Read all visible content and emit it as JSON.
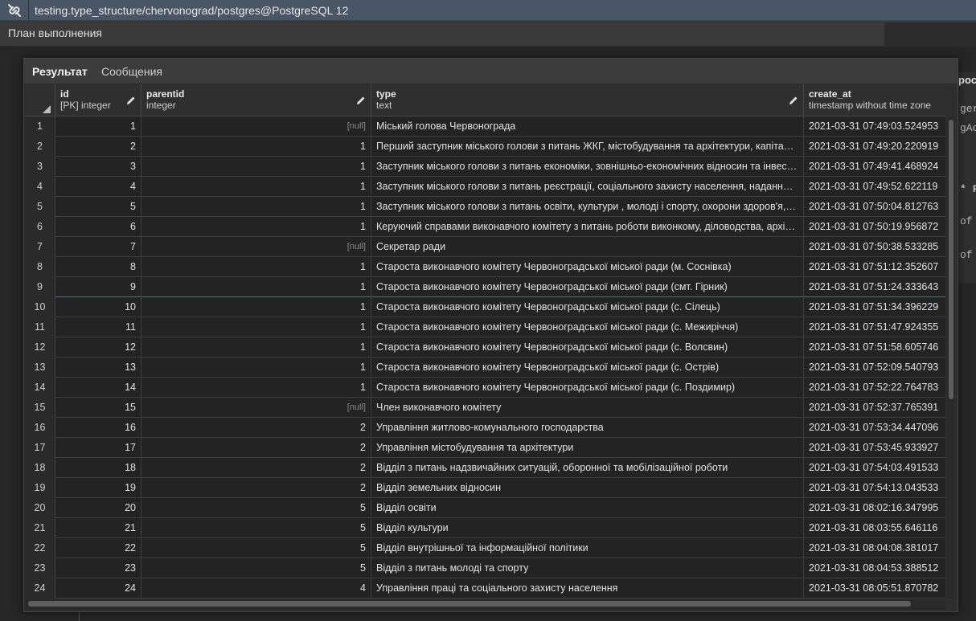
{
  "titlebar": {
    "title": "testing.type_structure/chervonograd/postgres@PostgreSQL 12",
    "icon": "connection-icon"
  },
  "plan_bar": {
    "label": "План выполнения"
  },
  "ghost_editor": {
    "header": "роc",
    "lines": [
      "ger",
      "gAc",
      "* F",
      "of",
      "of"
    ]
  },
  "result_tabs": [
    {
      "label": "Результат",
      "active": true
    },
    {
      "label": "Сообщения",
      "active": false
    }
  ],
  "columns": [
    {
      "name": "id",
      "type": "[PK] integer"
    },
    {
      "name": "parentid",
      "type": "integer"
    },
    {
      "name": "type",
      "type": "text"
    },
    {
      "name": "create_at",
      "type": "timestamp without time zone"
    }
  ],
  "rows": [
    [
      "1",
      "1",
      "[null]",
      "Міський голова Червонограда",
      "2021-03-31 07:49:03.524953"
    ],
    [
      "2",
      "2",
      "1",
      "Перший заступник міського голови з питань ЖКГ, містобудування та архітектури, капітальн...",
      "2021-03-31 07:49:20.220919"
    ],
    [
      "3",
      "3",
      "1",
      "Заступник міського голови з питань економіки, зовнішньо-економічних  відносин та інвест...",
      "2021-03-31 07:49:41.468924"
    ],
    [
      "4",
      "4",
      "1",
      "Заступник міського голови з питань реєстрації, соціального захисту населення, надання со...",
      "2021-03-31 07:49:52.622119"
    ],
    [
      "5",
      "5",
      "1",
      "Заступник міського голови з питань освіти, культури , молоді і спорту, охорони здоров'я, ін...",
      "2021-03-31 07:50:04.812763"
    ],
    [
      "6",
      "6",
      "1",
      "Керуючий справами виконавчого комітету з питань роботи виконкому, діловодства, архівн...",
      "2021-03-31 07:50:19.956872"
    ],
    [
      "7",
      "7",
      "[null]",
      "Секретар ради",
      "2021-03-31 07:50:38.533285"
    ],
    [
      "8",
      "8",
      "1",
      "Староста виконавчого комітету Червоноградської міської ради (м. Соснівка)",
      "2021-03-31 07:51:12.352607"
    ],
    [
      "9",
      "9",
      "1",
      "Староста виконавчого комітету Червоноградської міської ради (смт. Гірник)",
      "2021-03-31 07:51:24.333643"
    ],
    [
      "10",
      "10",
      "1",
      "Староста виконавчого комітету Червоноградської міської ради (с. Сілець)",
      "2021-03-31 07:51:34.396229"
    ],
    [
      "11",
      "11",
      "1",
      "Староста виконавчого комітету Червоноградської міської ради (с. Межиріччя)",
      "2021-03-31 07:51:47.924355"
    ],
    [
      "12",
      "12",
      "1",
      "Староста виконавчого комітету Червоноградської міської ради (с. Волсвин)",
      "2021-03-31 07:51:58.605746"
    ],
    [
      "13",
      "13",
      "1",
      "Староста виконавчого комітету Червоноградської міської ради (с. Острів)",
      "2021-03-31 07:52:09.540793"
    ],
    [
      "14",
      "14",
      "1",
      "Староста виконавчого комітету Червоноградської міської ради (с. Поздимир)",
      "2021-03-31 07:52:22.764783"
    ],
    [
      "15",
      "15",
      "[null]",
      "Член виконавчого комітету",
      "2021-03-31 07:52:37.765391"
    ],
    [
      "16",
      "16",
      "2",
      "Управління житлово-комунального господарства",
      "2021-03-31 07:53:34.447096"
    ],
    [
      "17",
      "17",
      "2",
      "Управління містобудування та архітектури",
      "2021-03-31 07:53:45.933927"
    ],
    [
      "18",
      "18",
      "2",
      "Відділ з питань надзвичайних ситуацій, оборонної та мобілізаційної роботи",
      "2021-03-31 07:54:03.491533"
    ],
    [
      "19",
      "19",
      "2",
      "Відділ земельних відносин",
      "2021-03-31 07:54:13.043533"
    ],
    [
      "20",
      "20",
      "5",
      "Відділ освіти",
      "2021-03-31 08:02:16.347995"
    ],
    [
      "21",
      "21",
      "5",
      "Відділ культури",
      "2021-03-31 08:03:55.646116"
    ],
    [
      "22",
      "22",
      "5",
      "Відділ внутрішньої та інформаційної політики",
      "2021-03-31 08:04:08.381017"
    ],
    [
      "23",
      "23",
      "5",
      "Відділ з питань молоді та спорту",
      "2021-03-31 08:04:53.388512"
    ],
    [
      "24",
      "24",
      "4",
      "Управління праці та соціального захисту населення",
      "2021-03-31 08:05:51.870782"
    ]
  ],
  "selected_row_index": 8
}
